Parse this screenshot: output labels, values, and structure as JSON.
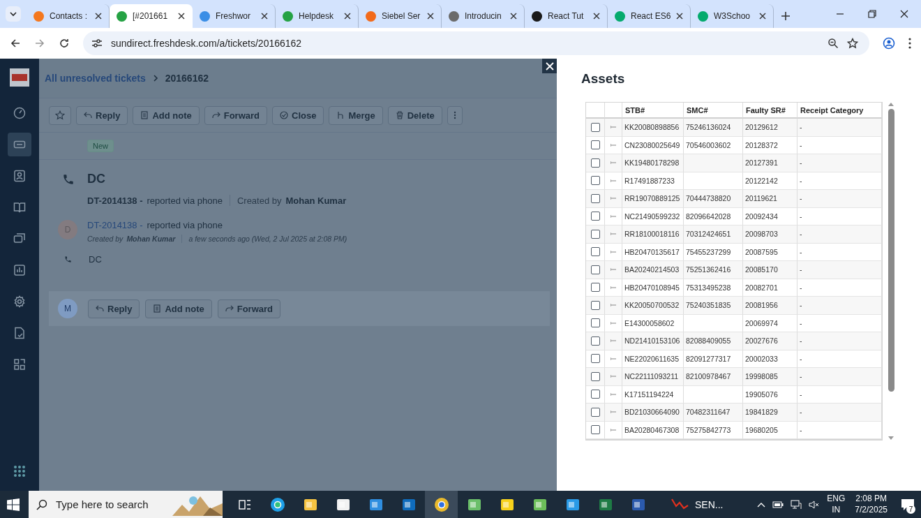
{
  "browser": {
    "tabs": [
      {
        "title": "Contacts :",
        "color": "#f4781f",
        "selected": false
      },
      {
        "title": "[#201661",
        "color": "#25a244",
        "selected": true
      },
      {
        "title": "Freshwor",
        "color": "#3a8ee6",
        "selected": false
      },
      {
        "title": "Helpdesk",
        "color": "#25a244",
        "selected": false
      },
      {
        "title": "Siebel Ser",
        "color": "#f26a1b",
        "selected": false
      },
      {
        "title": "Introducin",
        "color": "#6b6b6b",
        "selected": false
      },
      {
        "title": "React Tut",
        "color": "#1a1a1a",
        "selected": false
      },
      {
        "title": "React ES6",
        "color": "#04aa6d",
        "selected": false
      },
      {
        "title": "W3Schoo",
        "color": "#04aa6d",
        "selected": false
      }
    ],
    "url": "sundirect.freshdesk.com/a/tickets/20166162"
  },
  "sidebar": {
    "items": [
      {
        "kind": "dashboard",
        "selected": false
      },
      {
        "kind": "tickets",
        "selected": true
      },
      {
        "kind": "contacts",
        "selected": false
      },
      {
        "kind": "book",
        "selected": false
      },
      {
        "kind": "chat",
        "selected": false
      },
      {
        "kind": "reports",
        "selected": false
      },
      {
        "kind": "settings",
        "selected": false
      },
      {
        "kind": "document",
        "selected": false
      },
      {
        "kind": "widgets",
        "selected": false
      }
    ]
  },
  "breadcrumb": {
    "link": "All unresolved tickets",
    "current": "20166162"
  },
  "toolbar": [
    {
      "kind": "reply",
      "label": "Reply"
    },
    {
      "kind": "note",
      "label": "Add note"
    },
    {
      "kind": "forward",
      "label": "Forward"
    },
    {
      "kind": "close",
      "label": "Close"
    },
    {
      "kind": "merge",
      "label": "Merge"
    },
    {
      "kind": "delete",
      "label": "Delete"
    }
  ],
  "ticket": {
    "status": "New",
    "title": "DC",
    "id": "DT-2014138 -",
    "source": "reported via phone",
    "created_by_label": "Created by",
    "created_by": "Mohan Kumar"
  },
  "conversation": {
    "avatar": "D",
    "id": "DT-2014138 -",
    "source": "reported via phone",
    "created_by_label": "Created by",
    "created_by": "Mohan Kumar",
    "time": "a few seconds ago (Wed, 2 Jul 2025 at 2:08 PM)",
    "body": "DC"
  },
  "reply_bar": {
    "avatar": "M",
    "buttons": [
      {
        "kind": "reply",
        "label": "Reply"
      },
      {
        "kind": "note",
        "label": "Add note"
      },
      {
        "kind": "forward",
        "label": "Forward"
      }
    ]
  },
  "assets": {
    "title": "Assets",
    "columns": [
      "STB#",
      "SMC#",
      "Faulty SR#",
      "Receipt Category"
    ],
    "rows": [
      {
        "checked": false,
        "cells": [
          "KK20080898856",
          "75246136024",
          "20129612",
          "-"
        ]
      },
      {
        "checked": false,
        "cells": [
          "CN23080025649",
          "70546003602",
          "20128372",
          "-"
        ]
      },
      {
        "checked": false,
        "cells": [
          "KK19480178298",
          "",
          "20127391",
          "-"
        ]
      },
      {
        "checked": false,
        "cells": [
          "R17491887233",
          "",
          "20122142",
          "-"
        ]
      },
      {
        "checked": false,
        "cells": [
          "RR19070889125",
          "70444738820",
          "20119621",
          "-"
        ]
      },
      {
        "checked": false,
        "cells": [
          "NC21490599232",
          "82096642028",
          "20092434",
          "-"
        ]
      },
      {
        "checked": false,
        "cells": [
          "RR18100018116",
          "70312424651",
          "20098703",
          "-"
        ]
      },
      {
        "checked": false,
        "cells": [
          "HB20470135617",
          "75455237299",
          "20087595",
          "-"
        ]
      },
      {
        "checked": false,
        "cells": [
          "BA20240214503",
          "75251362416",
          "20085170",
          "-"
        ]
      },
      {
        "checked": false,
        "cells": [
          "HB20470108945",
          "75313495238",
          "20082701",
          "-"
        ]
      },
      {
        "checked": false,
        "cells": [
          "KK20050700532",
          "75240351835",
          "20081956",
          "-"
        ]
      },
      {
        "checked": false,
        "cells": [
          "E14300058602",
          "",
          "20069974",
          "-"
        ]
      },
      {
        "checked": false,
        "cells": [
          "ND21410153106",
          "82088409055",
          "20027676",
          "-"
        ]
      },
      {
        "checked": false,
        "cells": [
          "NE22020611635",
          "82091277317",
          "20002033",
          "-"
        ]
      },
      {
        "checked": false,
        "cells": [
          "NC22111093211",
          "82100978467",
          "19998085",
          "-"
        ]
      },
      {
        "checked": false,
        "cells": [
          "K17151194224",
          "",
          "19905076",
          "-"
        ]
      },
      {
        "checked": false,
        "cells": [
          "BD21030664090",
          "70482311647",
          "19841829",
          "-"
        ]
      },
      {
        "checked": false,
        "cells": [
          "BA20280467308",
          "75275842773",
          "19680205",
          "-"
        ]
      }
    ]
  },
  "taskbar": {
    "search_placeholder": "Type here to search",
    "apps": [
      {
        "kind": "taskview",
        "selected": false
      },
      {
        "kind": "edge",
        "selected": false
      },
      {
        "kind": "explorer",
        "selected": false
      },
      {
        "kind": "store",
        "selected": false
      },
      {
        "kind": "mail",
        "selected": false
      },
      {
        "kind": "outlook",
        "selected": false
      },
      {
        "kind": "chrome",
        "selected": true
      },
      {
        "kind": "media",
        "selected": false
      },
      {
        "kind": "notes",
        "selected": false
      },
      {
        "kind": "sheet",
        "selected": false
      },
      {
        "kind": "code",
        "selected": false
      },
      {
        "kind": "excel",
        "selected": false
      },
      {
        "kind": "word",
        "selected": false
      }
    ],
    "running_app": "SEN...",
    "language": "ENG",
    "region": "IN",
    "time": "2:08 PM",
    "date": "7/2/2025",
    "notifications": "7"
  }
}
